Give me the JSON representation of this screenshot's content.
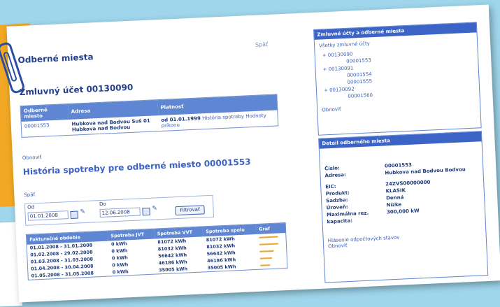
{
  "page": {
    "title": "Odberné miesta",
    "back_link": "Späť",
    "account_title": "Zmluvný účet 00130090"
  },
  "places_table": {
    "headers": [
      "Odberné miesto",
      "Adresa",
      "Platnosť"
    ],
    "rows": [
      {
        "id": "00001553",
        "address": "Hubkova nad Bodvou Suš 01 Hubkova nad Bodvou",
        "validity": "od 01.01.1999",
        "links": "História spotreby Hodnoty príkonu"
      }
    ]
  },
  "zobrazit_link": "Obnoviť",
  "history": {
    "title": "História spotreby pre odberné miesto 00001553",
    "back": "Späť",
    "from_label": "Od",
    "to_label": "Do",
    "from_value": "01.01.2008",
    "to_value": "12.06.2008",
    "filter_button": "Filtrovať",
    "headers": [
      "Fakturačné obdobie",
      "Spotreba JVT",
      "Spotreba VVT",
      "Spotreba spolu",
      "Graf"
    ],
    "rows": [
      {
        "period": "01.01.2008 - 31.01.2008",
        "jvt": "0 kWh",
        "vvt": "81072 kWh",
        "total": "81072 kWh",
        "bar": 0.9
      },
      {
        "period": "01.02.2008 - 29.02.2008",
        "jvt": "0 kWh",
        "vvt": "81032 kWh",
        "total": "81032 kWh",
        "bar": 0.9
      },
      {
        "period": "01.03.2008 - 31.03.2008",
        "jvt": "0 kWh",
        "vvt": "56642 kWh",
        "total": "56642 kWh",
        "bar": 0.65
      },
      {
        "period": "01.04.2008 - 30.04.2008",
        "jvt": "0 kWh",
        "vvt": "46186 kWh",
        "total": "46186 kWh",
        "bar": 0.55
      },
      {
        "period": "01.05.2008 - 31.05.2008",
        "jvt": "0 kWh",
        "vvt": "35005 kWh",
        "total": "35005 kWh",
        "bar": 0.45
      }
    ]
  },
  "tree_panel": {
    "title": "Zmluvné účty a odberné miesta",
    "intro": "Všetky zmluvné účty",
    "items": [
      "00130090",
      "00001553",
      "00130091",
      "00001554",
      "00001555",
      "00130092",
      "00001560"
    ],
    "link": "Obnoviť"
  },
  "detail_panel": {
    "title": "Detail odberného miesta",
    "fields": [
      {
        "k": "Číslo:",
        "v": "00001553"
      },
      {
        "k": "Adresa:",
        "v": "Hubkova nad Bodvou Bodvou"
      },
      {
        "k": "EIC:",
        "v": "24ZVS00000000"
      },
      {
        "k": "Produkt:",
        "v": "KLASIK"
      },
      {
        "k": "Sadzba:",
        "v": "Denná"
      },
      {
        "k": "Úroveň:",
        "v": "Nízke"
      },
      {
        "k": "Maximálna rez. kapacita:",
        "v": "300,000 kW"
      }
    ],
    "link1": "Hlásenie odpočtových stavov",
    "link2": "Obnoviť"
  }
}
